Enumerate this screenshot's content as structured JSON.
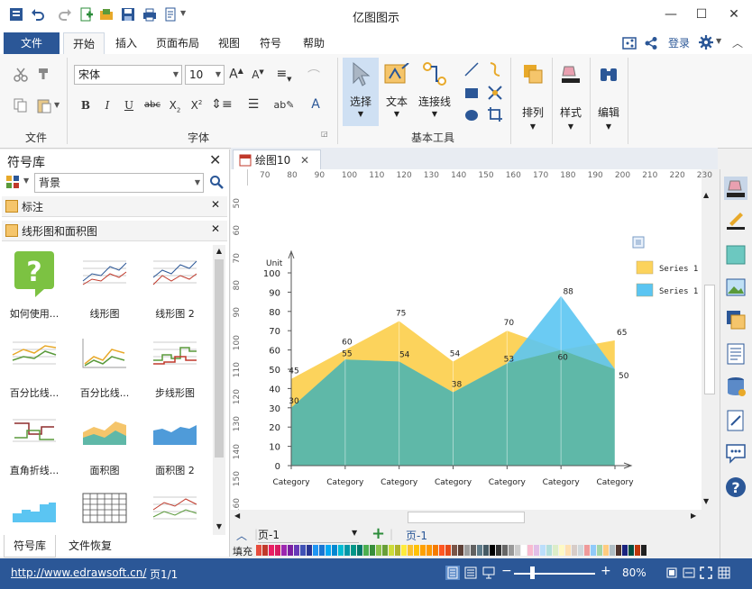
{
  "app": {
    "title": "亿图图示"
  },
  "ribbon_tabs": [
    "文件",
    "开始",
    "插入",
    "页面布局",
    "视图",
    "符号",
    "帮助"
  ],
  "header_right": {
    "login": "登录"
  },
  "ribbon": {
    "font_name": "宋体",
    "font_size": "10",
    "group_file": "文件",
    "group_font": "字体",
    "group_tools": "基本工具",
    "select": "选择",
    "text": "文本",
    "connector": "连接线",
    "arrange": "排列",
    "style": "样式",
    "edit": "编辑"
  },
  "left_panel": {
    "title": "符号库",
    "search_value": "背景",
    "libs": [
      "标注",
      "线形图和面积图"
    ],
    "shapes": [
      "如何使用...",
      "线形图",
      "线形图 2",
      "百分比线...",
      "百分比线...",
      "步线形图",
      "直角折线...",
      "面积图",
      "面积图 2",
      "",
      "",
      ""
    ],
    "bottom_tabs": [
      "符号库",
      "文件恢复"
    ]
  },
  "document": {
    "tab": "绘图10",
    "page_selector": "页-1",
    "page_tab": "页-1",
    "fill_label": "填充"
  },
  "ruler": {
    "h": [
      "70",
      "80",
      "90",
      "100",
      "110",
      "120",
      "130",
      "140",
      "150",
      "160",
      "170",
      "180",
      "190",
      "200",
      "210",
      "220",
      "230"
    ],
    "v": [
      "50",
      "60",
      "70",
      "80",
      "90",
      "100",
      "110",
      "120",
      "130",
      "140",
      "150",
      "160"
    ]
  },
  "status": {
    "url": "http://www.edrawsoft.cn/",
    "page": "页1/1",
    "zoom": "80%"
  },
  "chart_data": {
    "type": "area",
    "ylabel": "Unit",
    "ylim": [
      0,
      100
    ],
    "yticks": [
      "0",
      "10",
      "20",
      "30",
      "40",
      "50",
      "60",
      "70",
      "80",
      "90",
      "100"
    ],
    "categories": [
      "Category",
      "Category",
      "Category",
      "Category",
      "Category",
      "Category",
      "Category"
    ],
    "series": [
      {
        "name": "Series 1",
        "color": "#fcd35c",
        "values": [
          45,
          60,
          75,
          54,
          70,
          60,
          65
        ],
        "labels": [
          "45",
          "60",
          "75",
          "54",
          "70",
          "60",
          "65"
        ]
      },
      {
        "name": "Series 1",
        "color": "#5bc5f2",
        "values": [
          30,
          55,
          54,
          38,
          53,
          88,
          50
        ],
        "labels": [
          "30",
          "55",
          "54",
          "38",
          "53",
          "88",
          "50"
        ]
      }
    ],
    "overlap_color": "#5fb8a8",
    "legend": "top-right"
  }
}
